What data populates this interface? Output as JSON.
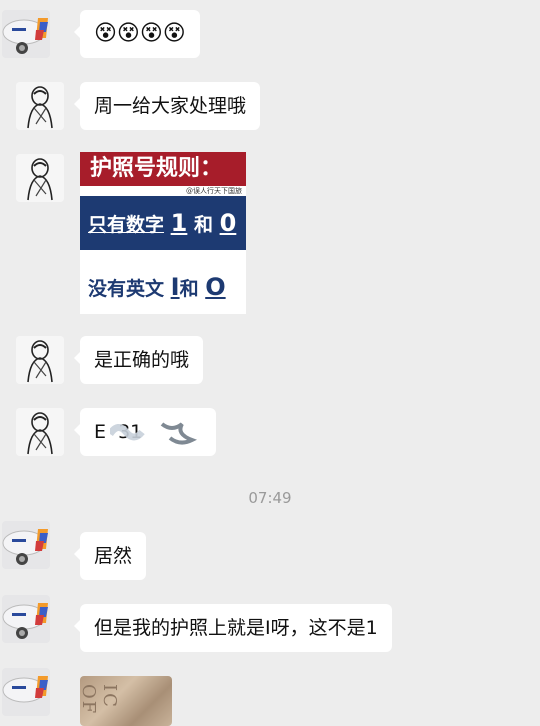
{
  "messages": {
    "m1_emoji": "😵😵😵😵",
    "m2": "周一给大家处理哦",
    "m4": "是正确的哦",
    "m5_partial": "E  31",
    "time": "07:49",
    "m6": "居然",
    "m7": "但是我的护照上就是I呀，这不是1"
  },
  "rules_image": {
    "title": "护照号规则：",
    "source": "@误人行天下国旅",
    "line1_prefix": "只有数字",
    "line1_a": "1",
    "line1_mid": "和",
    "line1_b": "0",
    "line2_prefix": "没有英文",
    "line2_a": "I",
    "line2_mid": "和",
    "line2_b": "O"
  },
  "photo_text": "IC OF",
  "colors": {
    "background": "#ededed",
    "bubble": "#ffffff",
    "header_red": "#a71d2a",
    "navy": "#1d3a72"
  }
}
